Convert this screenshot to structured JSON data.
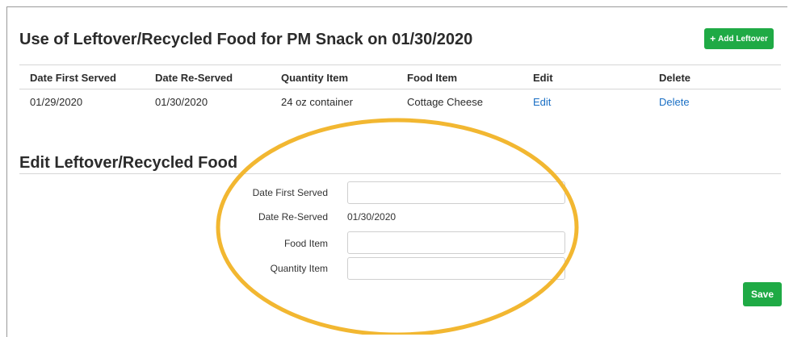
{
  "header": {
    "title": "Use of Leftover/Recycled Food for PM Snack on 01/30/2020",
    "add_button_label": "Add Leftover"
  },
  "table": {
    "columns": [
      "Date First Served",
      "Date Re-Served",
      "Quantity Item",
      "Food Item",
      "Edit",
      "Delete"
    ],
    "rows": [
      {
        "date_first_served": "01/29/2020",
        "date_re_served": "01/30/2020",
        "quantity_item": "24 oz container",
        "food_item": "Cottage Cheese",
        "edit": "Edit",
        "delete": "Delete"
      }
    ]
  },
  "form": {
    "title": "Edit Leftover/Recycled Food",
    "date_first_served_label": "Date First Served",
    "date_first_served_value": "",
    "date_re_served_label": "Date Re-Served",
    "date_re_served_value": "01/30/2020",
    "food_item_label": "Food Item",
    "food_item_value": "",
    "quantity_item_label": "Quantity Item",
    "quantity_item_value": "",
    "save_label": "Save"
  },
  "colors": {
    "accent_green": "#1faa45",
    "link_blue": "#1a6fc4",
    "highlight_yellow": "#f2b731"
  },
  "icons": {
    "add": "plus-icon"
  }
}
